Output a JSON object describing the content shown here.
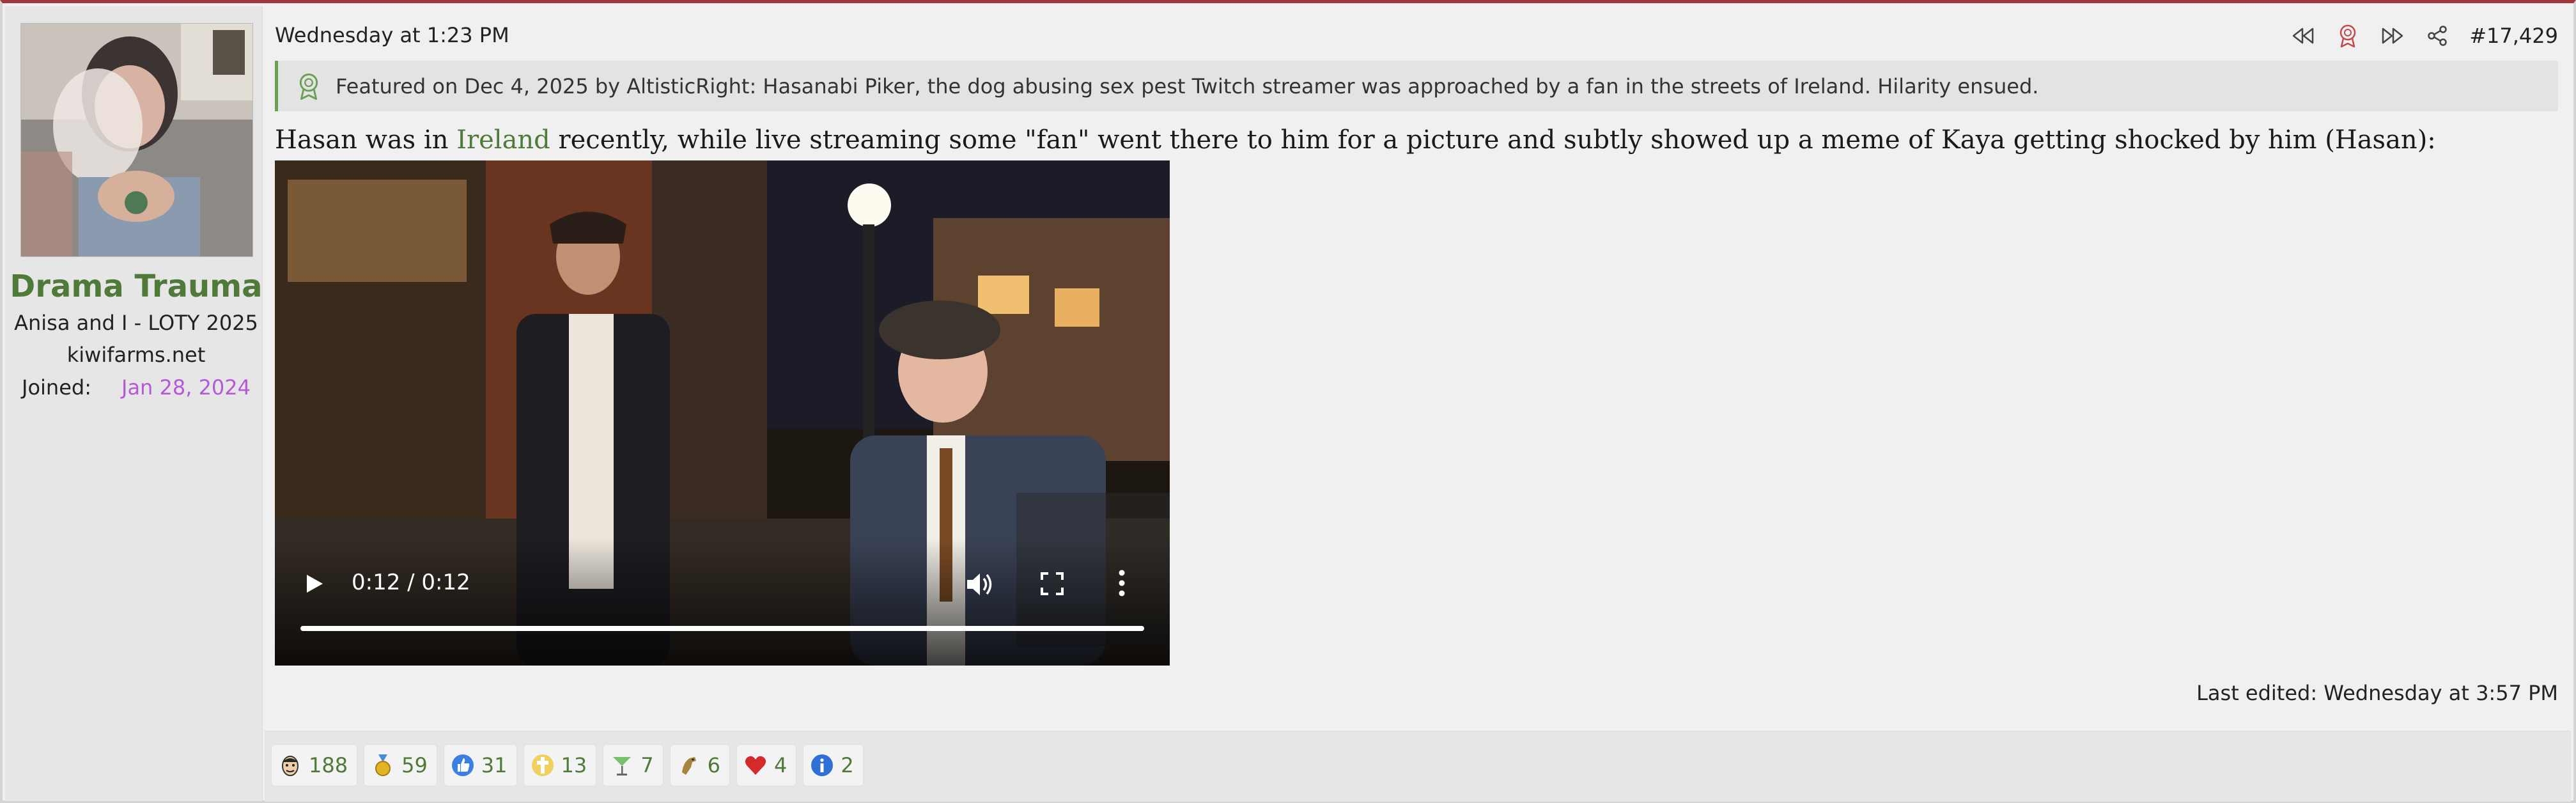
{
  "user": {
    "username": "Drama Trauma",
    "title": "Anisa and I - LOTY 2025",
    "url": "kiwifarms.net",
    "joined_label": "Joined:",
    "joined_date": "Jan 28, 2024",
    "colors": {
      "username": "#4f7a3a",
      "joined_date": "#b45ad8"
    }
  },
  "post": {
    "date": "Wednesday at 1:23 PM",
    "number": "#17,429",
    "tools": [
      "rewind-icon",
      "award-icon",
      "fast-forward-icon",
      "share-icon"
    ],
    "featured_text": "Featured on Dec 4, 2025 by AltisticRight: Hasanabi Piker, the dog abusing sex pest Twitch streamer was approached by a fan in the streets of Ireland. Hilarity ensued.",
    "body_before": "Hasan was in ",
    "body_link": "Ireland",
    "body_after": " recently, while live streaming some \"fan\" went there to him for a picture and subtly showed up a meme of Kaya getting shocked by him (Hasan):",
    "video": {
      "time": "0:12 / 0:12",
      "progress": 1.0
    },
    "last_edited": "Last edited: Wednesday at 3:57 PM",
    "accent_color": "#a3363a"
  },
  "reactions": [
    {
      "icon": "face-icon",
      "count": "188"
    },
    {
      "icon": "medal-icon",
      "count": "59"
    },
    {
      "icon": "thumbs-up-icon",
      "count": "31"
    },
    {
      "icon": "cross-icon",
      "count": "13"
    },
    {
      "icon": "cocktail-icon",
      "count": "7"
    },
    {
      "icon": "horse-icon",
      "count": "6"
    },
    {
      "icon": "heart-icon",
      "count": "4"
    },
    {
      "icon": "info-icon",
      "count": "2"
    }
  ]
}
